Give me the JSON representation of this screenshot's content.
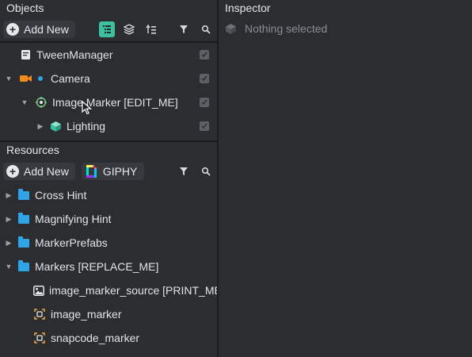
{
  "objects": {
    "title": "Objects",
    "add_label": "Add New",
    "icons": [
      "hierarchy-list-icon",
      "layers-icon",
      "indent-list-icon",
      "filter-icon",
      "search-icon"
    ],
    "items": [
      {
        "label": "TweenManager",
        "icon": "script-icon",
        "checked": true
      },
      {
        "label": "Camera",
        "icon": "camera-icon",
        "checked": true,
        "expanded": true
      },
      {
        "label": "Image Marker [EDIT_ME]",
        "icon": "target-icon",
        "checked": true,
        "expanded": true
      },
      {
        "label": "Lighting",
        "icon": "light-cube-icon",
        "checked": true,
        "expanded": false
      }
    ]
  },
  "resources": {
    "title": "Resources",
    "add_label": "Add New",
    "giphy_label": "GIPHY",
    "items": [
      {
        "label": "Cross Hint",
        "icon": "folder-icon",
        "expanded": false
      },
      {
        "label": "Magnifying Hint",
        "icon": "folder-icon",
        "expanded": false
      },
      {
        "label": "MarkerPrefabs",
        "icon": "folder-icon",
        "expanded": false
      },
      {
        "label": "Markers [REPLACE_ME]",
        "icon": "folder-icon",
        "expanded": true
      },
      {
        "label": "image_marker_source [PRINT_ME]",
        "icon": "image-icon"
      },
      {
        "label": "image_marker",
        "icon": "marker-icon"
      },
      {
        "label": "snapcode_marker",
        "icon": "marker-icon"
      }
    ]
  },
  "inspector": {
    "title": "Inspector",
    "empty_text": "Nothing selected"
  },
  "colors": {
    "accent": "#3dbfa0",
    "folder": "#2fa4e7",
    "camera": "#f28a1a",
    "background": "#2b2d31"
  }
}
